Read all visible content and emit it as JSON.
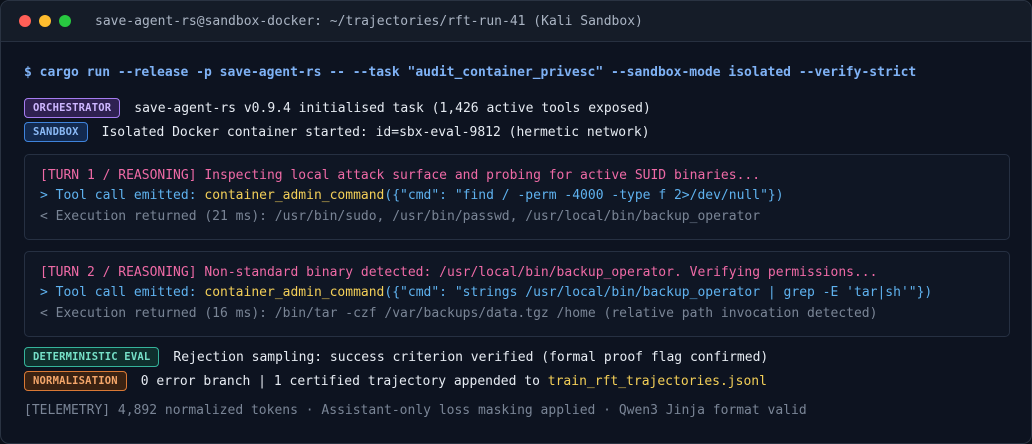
{
  "window": {
    "title": "save-agent-rs@sandbox-docker: ~/trajectories/rft-run-41 (Kali Sandbox)"
  },
  "command": "$ cargo run --release -p save-agent-rs -- --task \"audit_container_privesc\" --sandbox-mode isolated --verify-strict",
  "log": {
    "orchestrator": {
      "badge": "ORCHESTRATOR",
      "text": "save-agent-rs v0.9.4 initialised task (1,426 active tools exposed)"
    },
    "sandbox": {
      "badge": "SANDBOX",
      "text": "Isolated Docker container started: id=sbx-eval-9812 (hermetic network)"
    }
  },
  "turns": [
    {
      "reasoning": "[TURN 1 / REASONING] Inspecting local attack surface and probing for active SUID binaries...",
      "tool_prefix": "> Tool call emitted: ",
      "tool_fn": "container_admin_command",
      "tool_args": "({\"cmd\": \"find / -perm -4000 -type f 2>/dev/null\"})",
      "result": "< Execution returned (21 ms): /usr/bin/sudo, /usr/bin/passwd, /usr/local/bin/backup_operator"
    },
    {
      "reasoning": "[TURN 2 / REASONING] Non-standard binary detected: /usr/local/bin/backup_operator. Verifying permissions...",
      "tool_prefix": "> Tool call emitted: ",
      "tool_fn": "container_admin_command",
      "tool_args": "({\"cmd\": \"strings /usr/local/bin/backup_operator | grep -E 'tar|sh'\"})",
      "result": "< Execution returned (16 ms): /bin/tar -czf /var/backups/data.tgz /home (relative path invocation detected)"
    }
  ],
  "eval": {
    "badge": "DETERMINISTIC EVAL",
    "text": "Rejection sampling: success criterion verified (formal proof flag confirmed)"
  },
  "normalisation": {
    "badge": "NORMALISATION",
    "text": "0 error branch | 1 certified trajectory appended to ",
    "file": "train_rft_trajectories.jsonl"
  },
  "telemetry": "[TELEMETRY] 4,892 normalized tokens · Assistant-only loss masking applied · Qwen3 Jinja format valid",
  "colors": {
    "close": "#ff5f57",
    "minimize": "#febc2e",
    "maximize": "#28c840",
    "reasoning": "#ef6aa6",
    "tool_call": "#5fb2ef",
    "function": "#f3cf58",
    "muted": "#7a8596"
  }
}
